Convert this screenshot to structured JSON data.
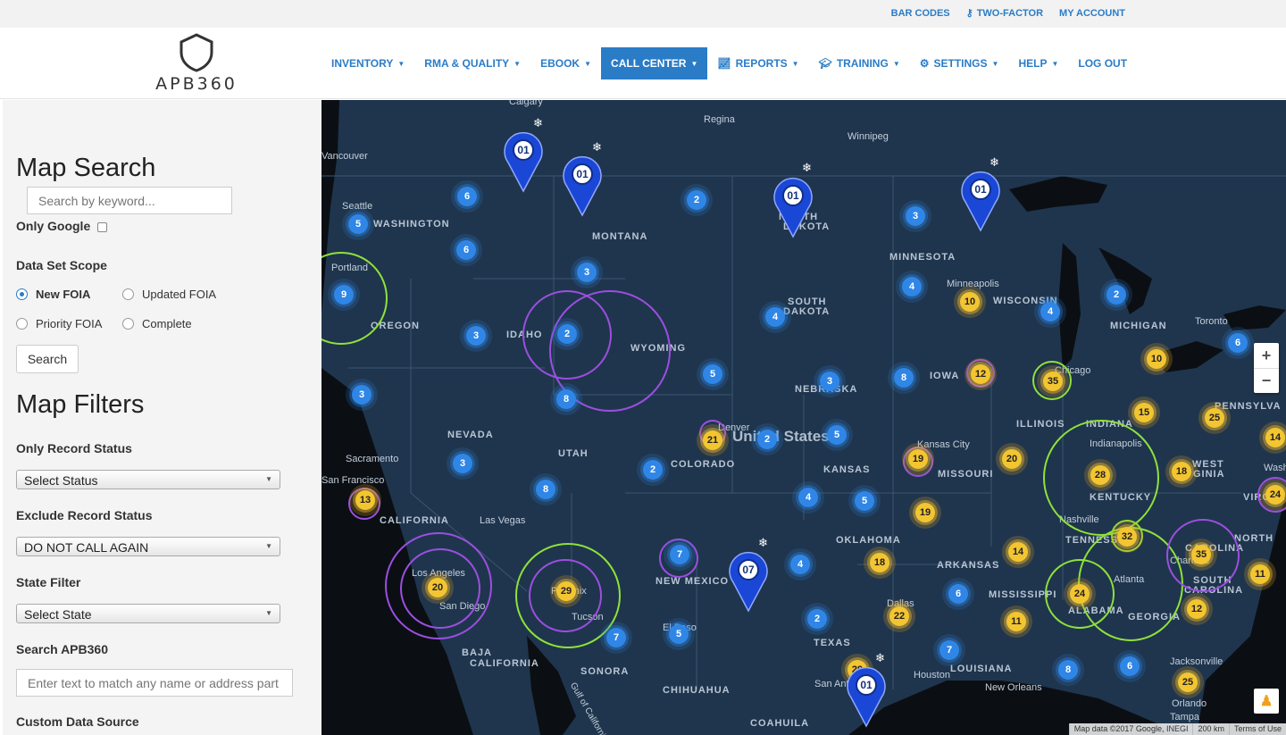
{
  "topbar": {
    "links": [
      {
        "label": "BAR CODES",
        "icon": ""
      },
      {
        "label": "TWO-FACTOR",
        "icon": "key-icon"
      },
      {
        "label": "MY ACCOUNT",
        "icon": ""
      }
    ]
  },
  "brand": {
    "name": "APB360",
    "icon": "shield-icon"
  },
  "nav": {
    "items": [
      {
        "label": "INVENTORY",
        "icon": ""
      },
      {
        "label": "RMA & QUALITY",
        "icon": ""
      },
      {
        "label": "EBOOK",
        "icon": ""
      },
      {
        "label": "CALL CENTER",
        "icon": "",
        "active": true
      },
      {
        "label": "REPORTS",
        "icon": "chart-icon"
      },
      {
        "label": "TRAINING",
        "icon": "graduation-cap-icon"
      },
      {
        "label": "SETTINGS",
        "icon": "cogs-icon"
      },
      {
        "label": "HELP",
        "icon": ""
      },
      {
        "label": "LOG OUT",
        "icon": ""
      }
    ],
    "active_color": "#2a7cc7"
  },
  "sidebar": {
    "map_search_title": "Map Search",
    "search_placeholder": "Search by keyword...",
    "only_google_label": "Only Google",
    "data_set_scope_label": "Data Set Scope",
    "scopes": [
      {
        "label": "New FOIA",
        "selected": true
      },
      {
        "label": "Updated FOIA",
        "selected": false
      },
      {
        "label": "Priority FOIA",
        "selected": false
      },
      {
        "label": "Complete",
        "selected": false
      }
    ],
    "search_button": "Search",
    "map_filters_title": "Map Filters",
    "only_record_status_label": "Only Record Status",
    "only_record_status_value": "Select Status",
    "exclude_record_status_label": "Exclude Record Status",
    "exclude_record_status_value": "DO NOT CALL AGAIN",
    "state_filter_label": "State Filter",
    "state_filter_value": "Select State",
    "search_apb_label": "Search APB360",
    "search_apb_placeholder": "Enter text to match any name or address part",
    "custom_data_source_label": "Custom Data Source"
  },
  "map": {
    "country_label": "United States",
    "regions": [
      "WASHINGTON",
      "MONTANA",
      "NORTH DAKOTA",
      "MINNESOTA",
      "OREGON",
      "IDAHO",
      "WYOMING",
      "SOUTH DAKOTA",
      "WISCONSIN",
      "MICHIGAN",
      "NEBRASKA",
      "IOWA",
      "NEVADA",
      "UTAH",
      "COLORADO",
      "KANSAS",
      "MISSOURI",
      "ILLINOIS",
      "INDIANA",
      "KENTUCKY",
      "CALIFORNIA",
      "OKLAHOMA",
      "ARKANSAS",
      "TENNESSEE",
      "NEW MEXICO",
      "TEXAS",
      "MISSISSIPPI",
      "ALABAMA",
      "GEORGIA",
      "LOUISIANA",
      "PENNSYLVANIA",
      "NORTH CAROLINA",
      "SOUTH CAROLINA",
      "BAJA CALIFORNIA",
      "SONORA",
      "CHIHUAHUA",
      "COAHUILA",
      "WEST VIRGINIA",
      "VIRGINIA"
    ],
    "cities": [
      "Calgary",
      "Regina",
      "Winnipeg",
      "Vancouver",
      "Seattle",
      "Portland",
      "Minneapolis",
      "Toronto",
      "Chicago",
      "Indianapolis",
      "Kansas City",
      "Denver",
      "Sacramento",
      "San Francisco",
      "Las Vegas",
      "Los Angeles",
      "San Diego",
      "Phoenix",
      "Tucson",
      "El Paso",
      "Dallas",
      "Houston",
      "San Antonio",
      "New Orleans",
      "Nashville",
      "Atlanta",
      "Charlotte",
      "Jacksonville",
      "Orlando",
      "Tampa",
      "Washington",
      "Gulf of California"
    ],
    "clusters": [
      {
        "count": "6",
        "color": "blue"
      },
      {
        "count": "5",
        "color": "blue"
      },
      {
        "count": "6",
        "color": "blue"
      },
      {
        "count": "9",
        "color": "blue"
      },
      {
        "count": "3",
        "color": "blue"
      },
      {
        "count": "2",
        "color": "blue"
      },
      {
        "count": "3",
        "color": "blue"
      },
      {
        "count": "3",
        "color": "blue"
      },
      {
        "count": "2",
        "color": "blue"
      },
      {
        "count": "4",
        "color": "blue"
      },
      {
        "count": "4",
        "color": "blue"
      },
      {
        "count": "10",
        "color": "yellow"
      },
      {
        "count": "2",
        "color": "blue"
      },
      {
        "count": "4",
        "color": "blue"
      },
      {
        "count": "6",
        "color": "blue"
      },
      {
        "count": "3",
        "color": "blue"
      },
      {
        "count": "8",
        "color": "blue"
      },
      {
        "count": "5",
        "color": "blue"
      },
      {
        "count": "3",
        "color": "blue"
      },
      {
        "count": "8",
        "color": "blue"
      },
      {
        "count": "12",
        "color": "yellow"
      },
      {
        "count": "35",
        "color": "yellow"
      },
      {
        "count": "10",
        "color": "yellow"
      },
      {
        "count": "3",
        "color": "blue"
      },
      {
        "count": "21",
        "color": "yellow"
      },
      {
        "count": "2",
        "color": "blue"
      },
      {
        "count": "5",
        "color": "blue"
      },
      {
        "count": "19",
        "color": "yellow"
      },
      {
        "count": "20",
        "color": "yellow"
      },
      {
        "count": "28",
        "color": "yellow"
      },
      {
        "count": "15",
        "color": "yellow"
      },
      {
        "count": "25",
        "color": "yellow"
      },
      {
        "count": "14",
        "color": "yellow"
      },
      {
        "count": "13",
        "color": "yellow"
      },
      {
        "count": "8",
        "color": "blue"
      },
      {
        "count": "2",
        "color": "blue"
      },
      {
        "count": "4",
        "color": "blue"
      },
      {
        "count": "5",
        "color": "blue"
      },
      {
        "count": "19",
        "color": "yellow"
      },
      {
        "count": "18",
        "color": "yellow"
      },
      {
        "count": "24",
        "color": "yellow"
      },
      {
        "count": "20",
        "color": "yellow"
      },
      {
        "count": "29",
        "color": "yellow"
      },
      {
        "count": "7",
        "color": "blue"
      },
      {
        "count": "4",
        "color": "blue"
      },
      {
        "count": "18",
        "color": "yellow"
      },
      {
        "count": "14",
        "color": "yellow"
      },
      {
        "count": "32",
        "color": "yellow"
      },
      {
        "count": "35",
        "color": "yellow"
      },
      {
        "count": "11",
        "color": "yellow"
      },
      {
        "count": "6",
        "color": "blue"
      },
      {
        "count": "24",
        "color": "yellow"
      },
      {
        "count": "12",
        "color": "yellow"
      },
      {
        "count": "7",
        "color": "blue"
      },
      {
        "count": "5",
        "color": "blue"
      },
      {
        "count": "2",
        "color": "blue"
      },
      {
        "count": "22",
        "color": "yellow"
      },
      {
        "count": "11",
        "color": "yellow"
      },
      {
        "count": "7",
        "color": "blue"
      },
      {
        "count": "29",
        "color": "yellow"
      },
      {
        "count": "8",
        "color": "blue"
      },
      {
        "count": "6",
        "color": "blue"
      },
      {
        "count": "25",
        "color": "yellow"
      }
    ],
    "pins": [
      {
        "label": "01"
      },
      {
        "label": "01"
      },
      {
        "label": "01"
      },
      {
        "label": "01"
      },
      {
        "label": "07"
      },
      {
        "label": "01"
      }
    ],
    "zoom_in": "+",
    "zoom_out": "−",
    "attribution": [
      "Map data ©2017 Google, INEGI",
      "200 km",
      "Terms of Use"
    ]
  }
}
